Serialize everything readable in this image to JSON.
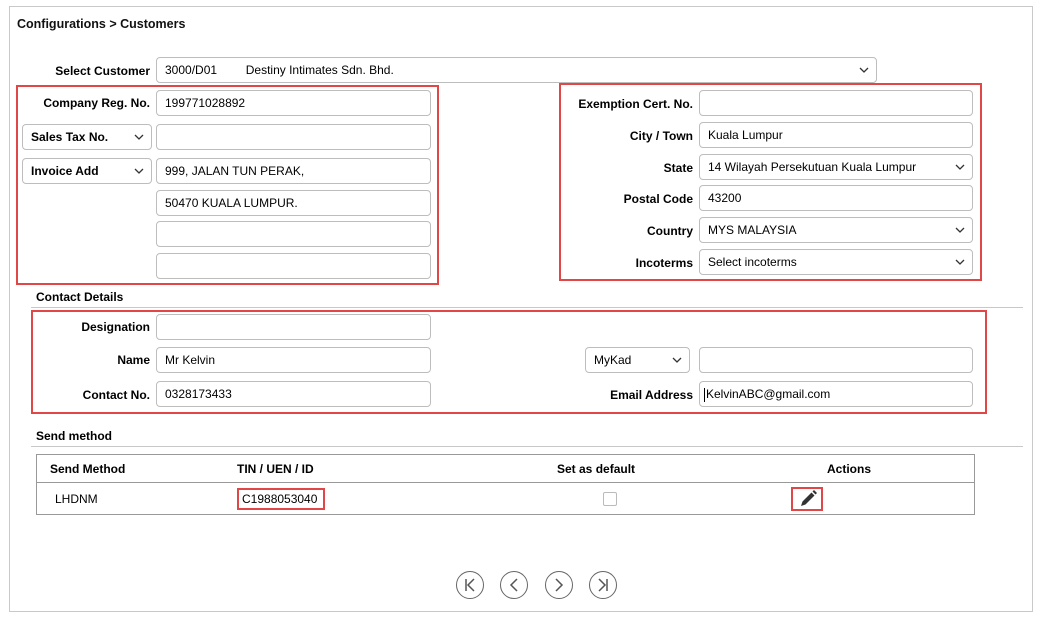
{
  "breadcrumb": "Configurations > Customers",
  "customer": {
    "label": "Select Customer",
    "code": "3000/D01",
    "name": "Destiny Intimates Sdn. Bhd."
  },
  "left": {
    "company_reg_label": "Company Reg. No.",
    "company_reg_value": "199771028892",
    "sales_tax_select": "Sales Tax No.",
    "sales_tax_value": "",
    "invoice_select": "Invoice Add",
    "address_lines": [
      "999, JALAN TUN PERAK,",
      "50470 KUALA LUMPUR.",
      "",
      ""
    ]
  },
  "right": {
    "exemption_label": "Exemption Cert. No.",
    "exemption_value": "",
    "city_label": "City / Town",
    "city_value": "Kuala Lumpur",
    "state_label": "State",
    "state_value": "14 Wilayah Persekutuan Kuala Lumpur",
    "postal_label": "Postal Code",
    "postal_value": "43200",
    "country_label": "Country",
    "country_value": "MYS MALAYSIA",
    "incoterms_label": "Incoterms",
    "incoterms_value": "Select incoterms"
  },
  "contact": {
    "section_title": "Contact Details",
    "designation_label": "Designation",
    "designation_value": "",
    "name_label": "Name",
    "name_value": "Mr Kelvin",
    "id_type_select": "MyKad",
    "id_value": "",
    "contact_label": "Contact No.",
    "contact_value": "0328173433",
    "email_label": "Email Address",
    "email_value": "KelvinABC@gmail.com"
  },
  "send_method": {
    "section_title": "Send method",
    "columns": [
      "Send Method",
      "TIN / UEN / ID",
      "Set as default",
      "Actions"
    ],
    "rows": [
      {
        "method": "LHDNM",
        "tin": "C1988053040",
        "is_default": false,
        "action_icon": "pencil-icon"
      }
    ]
  },
  "pager": {
    "icons": [
      "first-page-icon",
      "prev-page-icon",
      "next-page-icon",
      "last-page-icon"
    ]
  },
  "colors": {
    "highlight": "#e04848",
    "border": "#bdbdbd",
    "icon": "#333333"
  }
}
